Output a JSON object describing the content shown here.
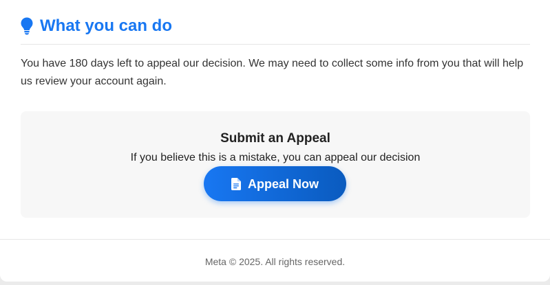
{
  "section": {
    "title": "What you can do",
    "title_icon": "lightbulb-icon",
    "body": "You have 180 days left to appeal our decision. We may need to collect some info from you that will help us review your account again."
  },
  "appeal": {
    "title": "Submit an Appeal",
    "subtitle": "If you believe this is a mistake, you can appeal our decision",
    "button_label": "Appeal Now",
    "button_icon": "document-icon"
  },
  "footer": {
    "text": "Meta © 2025. All rights reserved."
  },
  "colors": {
    "accent": "#1877f2",
    "accent_dark": "#0a5bbf",
    "text": "#333333",
    "muted": "#666666",
    "panel": "#f7f7f7"
  }
}
